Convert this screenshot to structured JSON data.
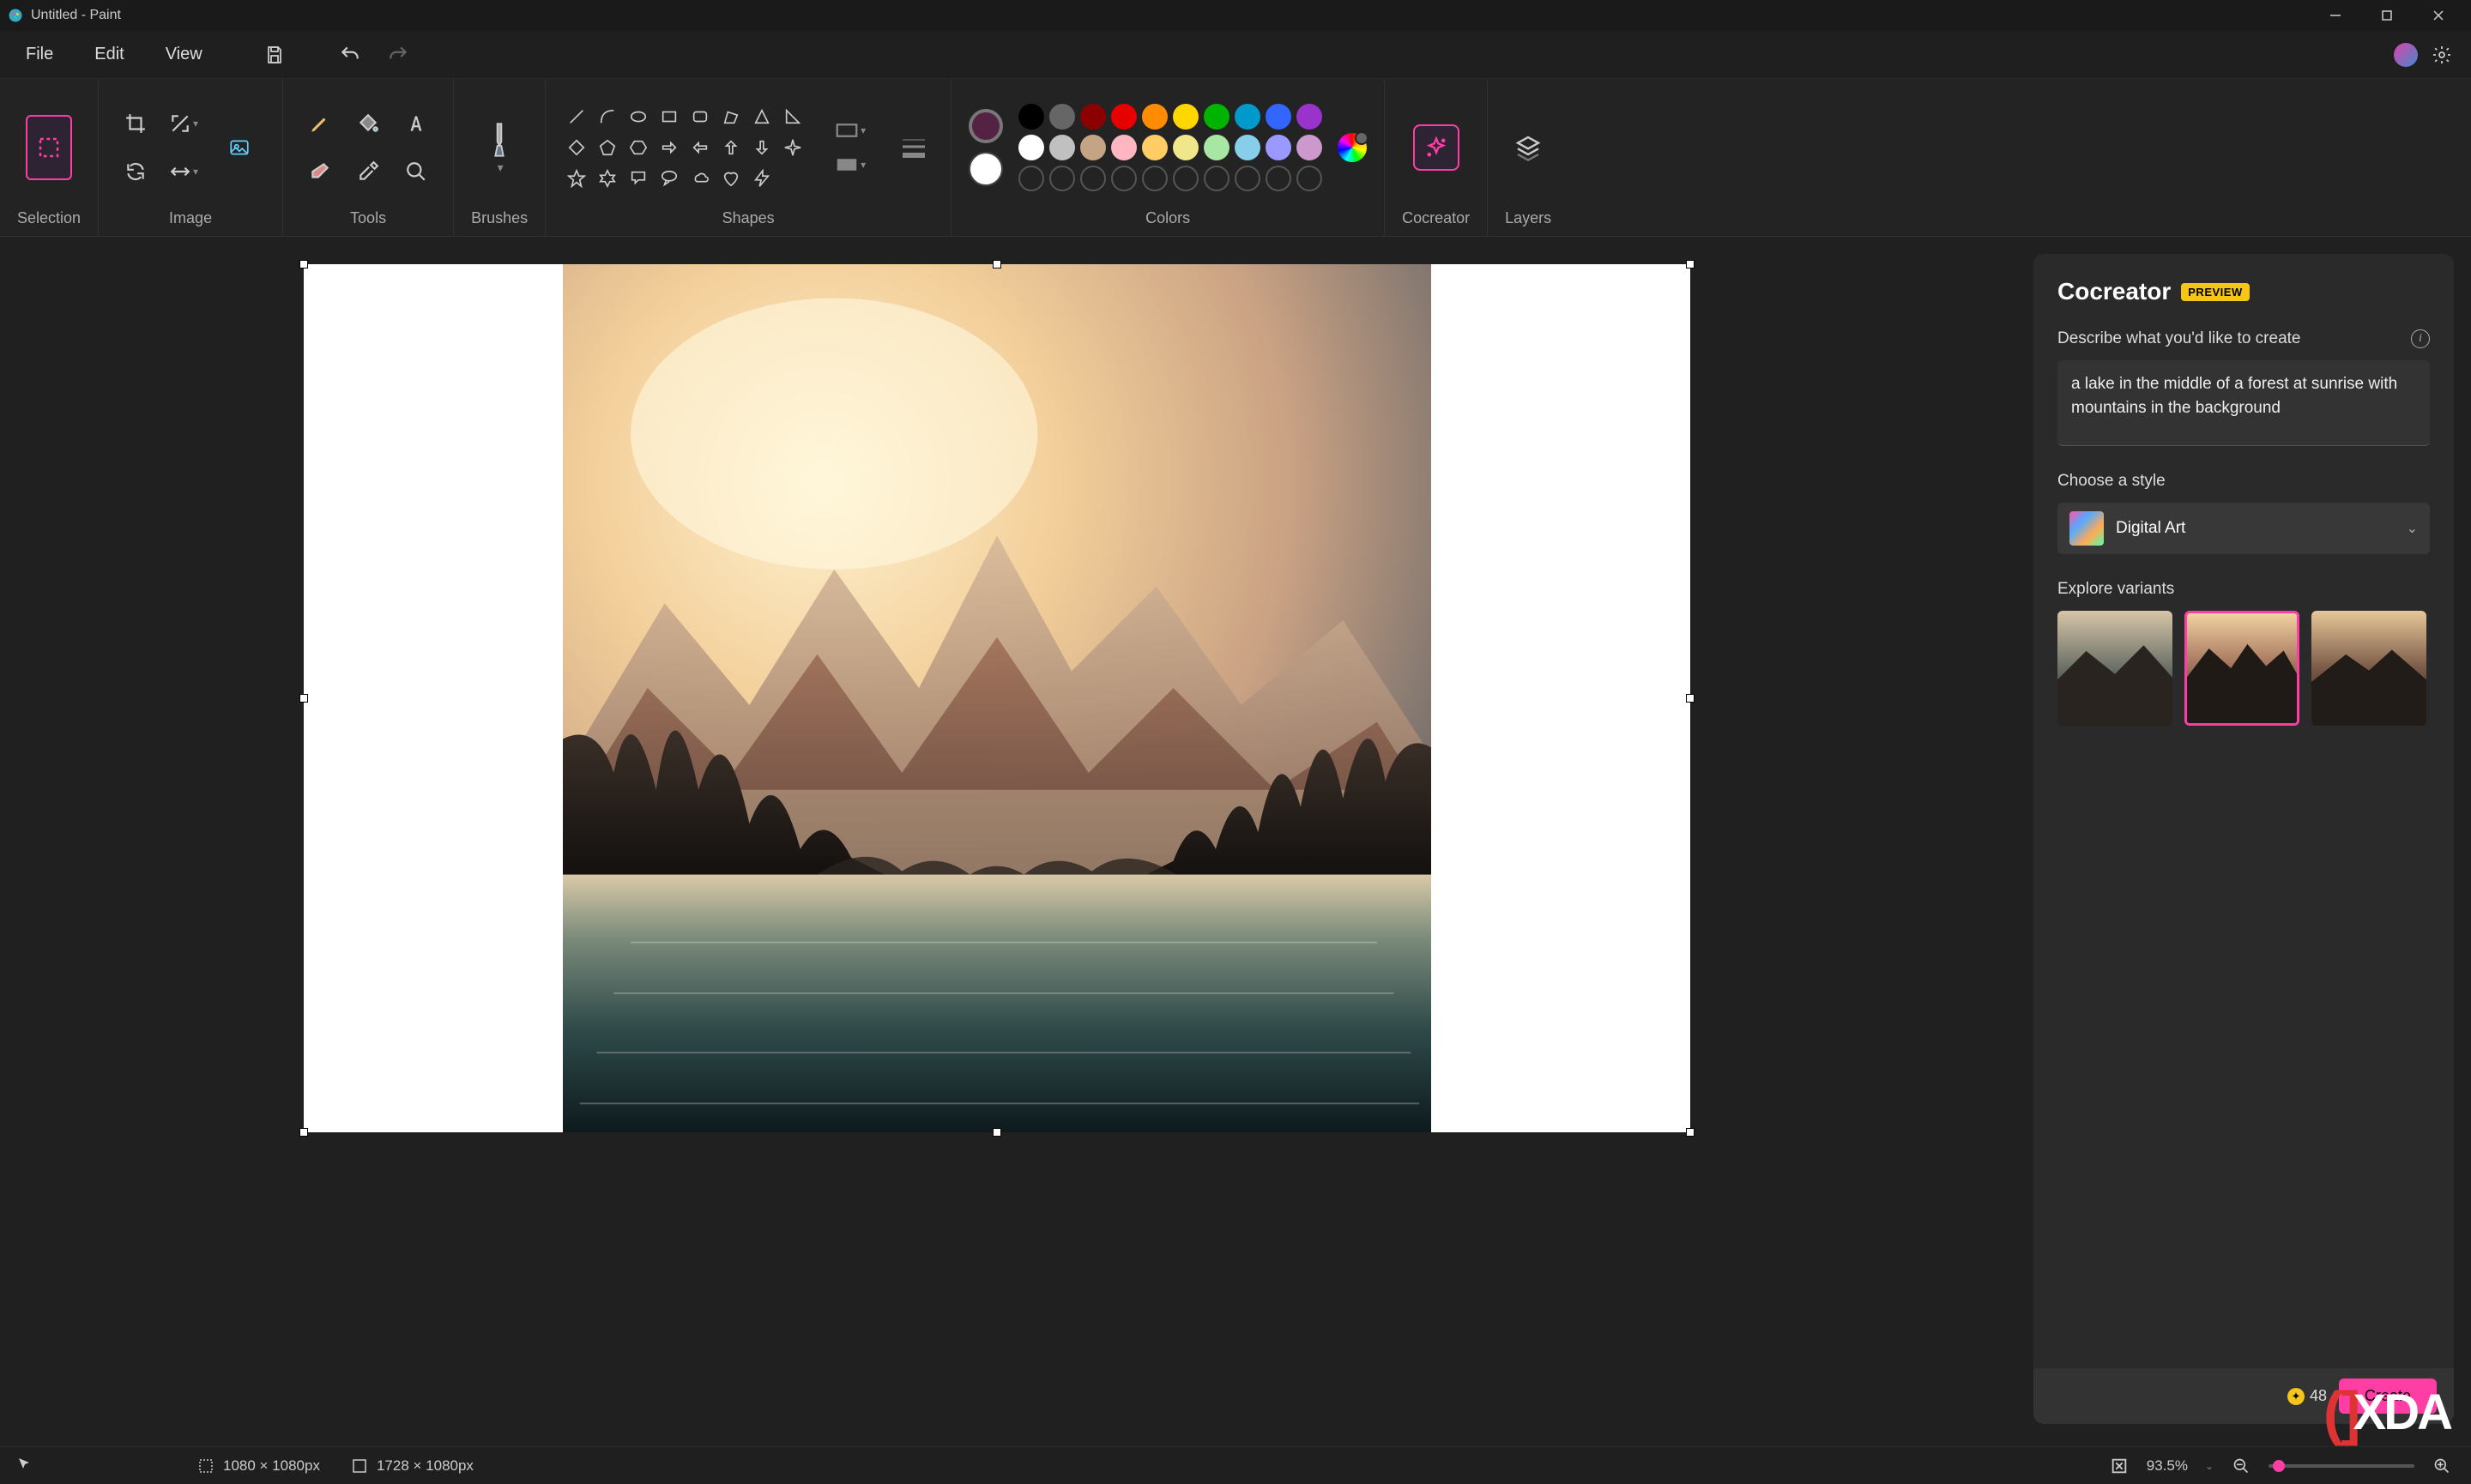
{
  "titlebar": {
    "title": "Untitled - Paint"
  },
  "menu": {
    "file": "File",
    "edit": "Edit",
    "view": "View"
  },
  "ribbon": {
    "selection": "Selection",
    "image": "Image",
    "tools": "Tools",
    "brushes": "Brushes",
    "shapes": "Shapes",
    "colors": "Colors",
    "cocreator": "Cocreator",
    "layers": "Layers"
  },
  "palette_row1": [
    "#000000",
    "#666666",
    "#8b0000",
    "#e60000",
    "#ff8c00",
    "#ffd700",
    "#00b300",
    "#0099cc",
    "#3366ff",
    "#9933cc"
  ],
  "palette_row2": [
    "#ffffff",
    "#c0c0c0",
    "#c4a484",
    "#ffb6c1",
    "#ffcc66",
    "#f0e68c",
    "#a8e6a3",
    "#87ceeb",
    "#9999ff",
    "#cc99cc"
  ],
  "color_primary": "#552244",
  "color_secondary": "#ffffff",
  "cocreator": {
    "title": "Cocreator",
    "badge": "PREVIEW",
    "describe_label": "Describe what you'd like to create",
    "prompt": "a lake in the middle of a forest at sunrise with mountains in the background",
    "style_label": "Choose a style",
    "style_selected": "Digital Art",
    "variants_label": "Explore variants",
    "credits": "48",
    "create_btn": "Create",
    "selected_variant": 1
  },
  "statusbar": {
    "selection_size": "1080 × 1080px",
    "canvas_size": "1728 × 1080px",
    "zoom": "93.5%"
  },
  "watermark": "XDA"
}
